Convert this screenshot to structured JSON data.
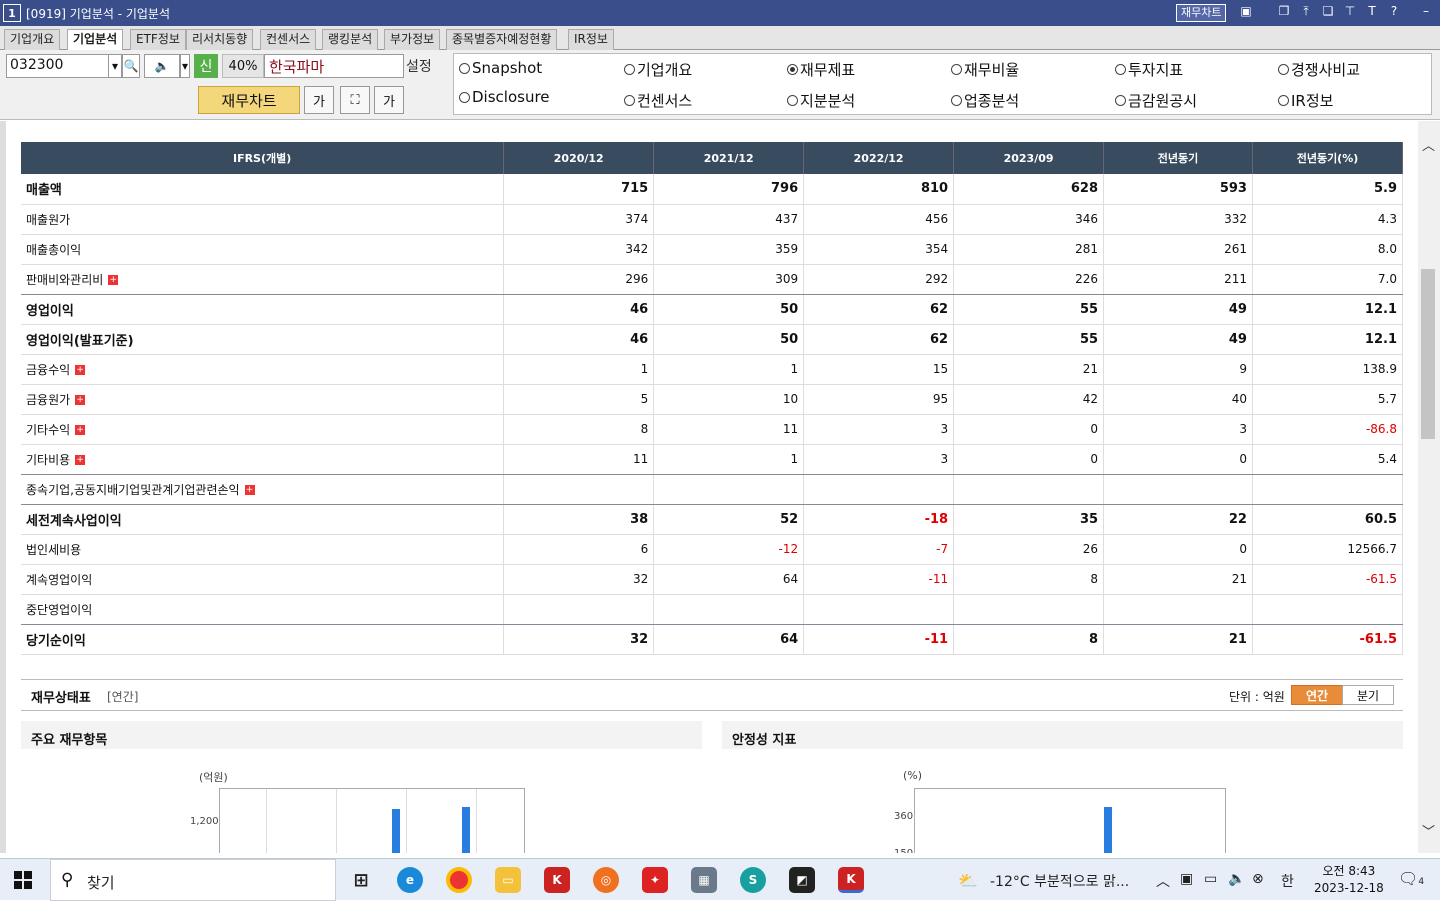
{
  "window": {
    "app_num": "1",
    "title": "[0919] 기업분석 - 기업분석",
    "finchart_label": "재무차트",
    "title_icons": [
      "box",
      "up",
      "window",
      "pin",
      "T",
      "?",
      "–",
      "▫",
      "✕"
    ]
  },
  "tabs": [
    {
      "label": "기업개요"
    },
    {
      "label": "기업분석"
    },
    {
      "label": "ETF정보"
    },
    {
      "label": "리서치동향"
    },
    {
      "label": "컨센서스"
    },
    {
      "label": "랭킹분석"
    },
    {
      "label": "부가정보"
    },
    {
      "label": "종목별증자예정현황"
    },
    {
      "label": "IR정보"
    }
  ],
  "toolbar": {
    "code": "032300",
    "sin": "신",
    "pct": "40%",
    "company": "한국파마",
    "settings": "설정",
    "finchart_button": "재무차트",
    "icon_btn1": "가",
    "icon_btn3": "가"
  },
  "radios": [
    {
      "label": "Snapshot",
      "selected": false
    },
    {
      "label": "기업개요",
      "selected": false
    },
    {
      "label": "재무제표",
      "selected": true
    },
    {
      "label": "재무비율",
      "selected": false
    },
    {
      "label": "투자지표",
      "selected": false
    },
    {
      "label": "경쟁사비교",
      "selected": false
    },
    {
      "label": "Disclosure",
      "selected": false
    },
    {
      "label": "컨센서스",
      "selected": false
    },
    {
      "label": "지분분석",
      "selected": false
    },
    {
      "label": "업종분석",
      "selected": false
    },
    {
      "label": "금감원공시",
      "selected": false
    },
    {
      "label": "IR정보",
      "selected": false
    }
  ],
  "table": {
    "headers": [
      "IFRS(개별)",
      "2020/12",
      "2021/12",
      "2022/12",
      "2023/09",
      "전년동기",
      "전년동기(%)"
    ],
    "rows": [
      {
        "label": "매출액",
        "bold": true,
        "plus": false,
        "values": [
          "715",
          "796",
          "810",
          "628",
          "593",
          "5.9"
        ]
      },
      {
        "label": "매출원가",
        "bold": false,
        "plus": false,
        "values": [
          "374",
          "437",
          "456",
          "346",
          "332",
          "4.3"
        ]
      },
      {
        "label": "매출총이익",
        "bold": false,
        "plus": false,
        "values": [
          "342",
          "359",
          "354",
          "281",
          "261",
          "8.0"
        ]
      },
      {
        "label": "판매비와관리비",
        "bold": false,
        "plus": true,
        "values": [
          "296",
          "309",
          "292",
          "226",
          "211",
          "7.0"
        ]
      },
      {
        "label": "영업이익",
        "bold": true,
        "plus": false,
        "values": [
          "46",
          "50",
          "62",
          "55",
          "49",
          "12.1"
        ]
      },
      {
        "label": "영업이익(발표기준)",
        "bold": true,
        "plus": false,
        "values": [
          "46",
          "50",
          "62",
          "55",
          "49",
          "12.1"
        ]
      },
      {
        "label": "금융수익",
        "bold": false,
        "plus": true,
        "values": [
          "1",
          "1",
          "15",
          "21",
          "9",
          "138.9"
        ]
      },
      {
        "label": "금융원가",
        "bold": false,
        "plus": true,
        "values": [
          "5",
          "10",
          "95",
          "42",
          "40",
          "5.7"
        ]
      },
      {
        "label": "기타수익",
        "bold": false,
        "plus": true,
        "values": [
          "8",
          "11",
          "3",
          "0",
          "3",
          "-86.8"
        ]
      },
      {
        "label": "기타비용",
        "bold": false,
        "plus": true,
        "values": [
          "11",
          "1",
          "3",
          "0",
          "0",
          "5.4"
        ]
      },
      {
        "label": "종속기업,공동지배기업및관계기업관련손익",
        "bold": false,
        "plus": true,
        "values": [
          "",
          "",
          "",
          "",
          "",
          ""
        ]
      },
      {
        "label": "세전계속사업이익",
        "bold": true,
        "plus": false,
        "values": [
          "38",
          "52",
          "-18",
          "35",
          "22",
          "60.5"
        ]
      },
      {
        "label": "법인세비용",
        "bold": false,
        "plus": false,
        "values": [
          "6",
          "-12",
          "-7",
          "26",
          "0",
          "12566.7"
        ]
      },
      {
        "label": "계속영업이익",
        "bold": false,
        "plus": false,
        "values": [
          "32",
          "64",
          "-11",
          "8",
          "21",
          "-61.5"
        ]
      },
      {
        "label": "중단영업이익",
        "bold": false,
        "plus": false,
        "values": [
          "",
          "",
          "",
          "",
          "",
          ""
        ]
      },
      {
        "label": "당기순이익",
        "bold": true,
        "plus": false,
        "values": [
          "32",
          "64",
          "-11",
          "8",
          "21",
          "-61.5"
        ]
      }
    ]
  },
  "balance": {
    "title": "재무상태표",
    "sub": "[연간]",
    "unit": "단위 : 억원",
    "annual": "연간",
    "quarter": "분기"
  },
  "panel_left": {
    "title": "주요 재무항목",
    "unit": "(억원)",
    "tick": "1,200"
  },
  "panel_right": {
    "title": "안정성 지표",
    "unit": "(%)",
    "tick": "360",
    "tick2": "150"
  },
  "taskbar": {
    "search": "찾기",
    "weather": "-12°C  부분적으로 맑...",
    "ime": "한",
    "time": "오전 8:43",
    "date": "2023-12-18",
    "notif": "4"
  }
}
